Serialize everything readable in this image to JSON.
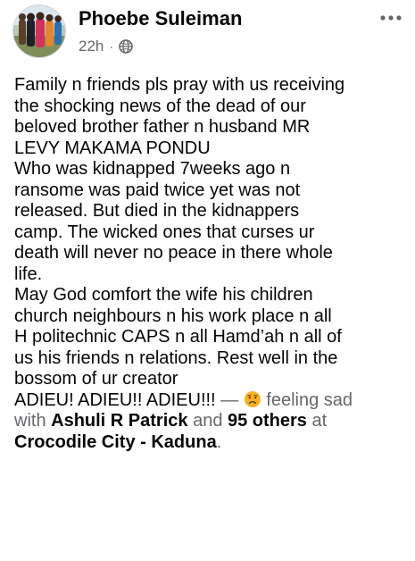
{
  "post": {
    "author": "Phoebe Suleiman",
    "time": "22h",
    "separator": "·",
    "privacy_icon": "globe-icon",
    "more_icon": "more-horizontal-icon",
    "body_lines": [
      "Family n friends pls pray with us receiving\nthe shocking news of the dead of our\nbeloved brother father n husband MR\nLEVY MAKAMA PONDU",
      "Who was kidnapped 7weeks ago n\nransome was paid twice yet was not\nreleased. But died in the kidnappers\ncamp. The wicked ones that curses ur\ndeath will never no peace in there whole\nlife.",
      "May God comfort the wife his children\nchurch neighbours n his work place n all\nH politechnic CAPS n all Hamd’ah n all of\nus his friends n relations. Rest well in the\nbossom of ur creator",
      "ADIEU! ADIEU!! ADIEU!!!"
    ],
    "activity": {
      "dash": " — ",
      "feeling_icon": "sad-face-icon",
      "feeling_text": " feeling sad",
      "with_text": "with ",
      "tagged_person": "Ashuli R Patrick",
      "and_text": " and ",
      "others": "95 others",
      "at_text": " at",
      "location": "Crocodile  City - Kaduna",
      "period": "."
    }
  },
  "colors": {
    "text": "#050505",
    "secondary": "#65676b",
    "feeling_emoji": "#f7b125"
  }
}
